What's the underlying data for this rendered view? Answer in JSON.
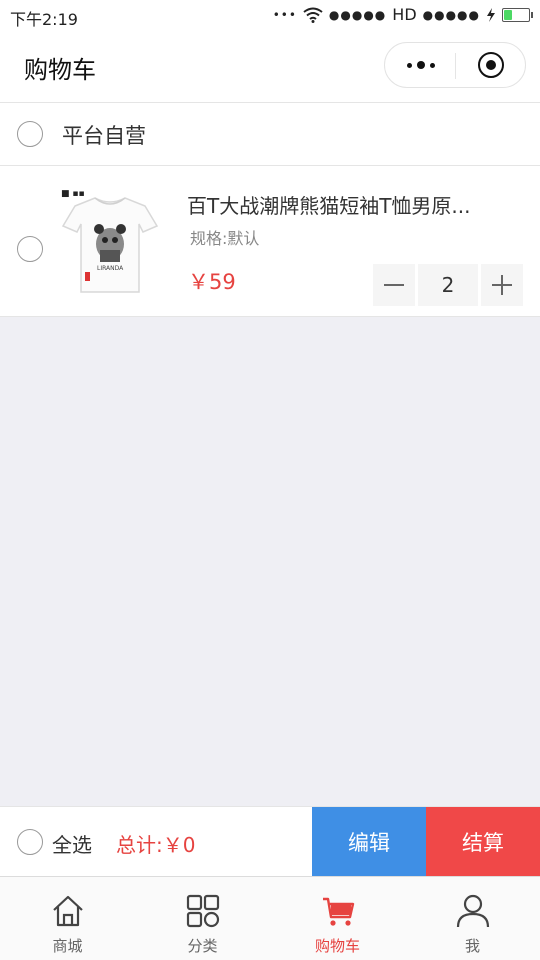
{
  "status_bar": {
    "time": "下午2:19",
    "network": "HD"
  },
  "navbar": {
    "title": "购物车"
  },
  "store": {
    "name": "平台自营"
  },
  "cart_items": [
    {
      "name": "百T大战潮牌熊猫短袖T恤男原...",
      "spec": "规格:默认",
      "price": "￥59",
      "quantity": "2"
    }
  ],
  "summary": {
    "select_all": "全选",
    "total": "总计:￥0",
    "edit": "编辑",
    "checkout": "结算"
  },
  "tabbar": {
    "items": [
      {
        "label": "商城",
        "icon": "home-icon"
      },
      {
        "label": "分类",
        "icon": "category-icon"
      },
      {
        "label": "购物车",
        "icon": "cart-icon",
        "active": true
      },
      {
        "label": "我",
        "icon": "user-icon"
      }
    ]
  },
  "colors": {
    "accent_red": "#e64340",
    "edit_blue": "#3f8fe5",
    "checkout_red": "#f04848",
    "battery_green": "#4cd964"
  }
}
